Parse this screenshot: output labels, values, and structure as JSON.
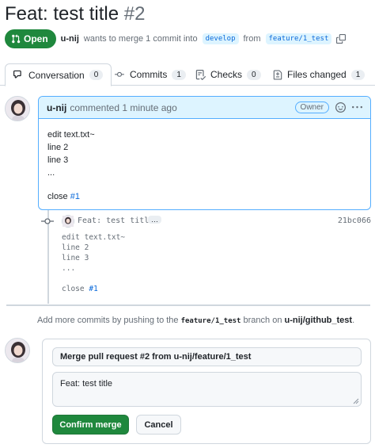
{
  "pr": {
    "title": "Feat: test title",
    "number": "#2",
    "state": "Open",
    "author": "u-nij",
    "merge_text": "wants to merge 1 commit into",
    "base_branch": "develop",
    "from_text": "from",
    "head_branch": "feature/1_test"
  },
  "tabs": [
    {
      "label": "Conversation",
      "count": "0"
    },
    {
      "label": "Commits",
      "count": "1"
    },
    {
      "label": "Checks",
      "count": "0"
    },
    {
      "label": "Files changed",
      "count": "1"
    }
  ],
  "comment": {
    "author": "u-nij",
    "meta": "commented 1 minute ago",
    "role": "Owner",
    "lines": [
      "edit text.txt~",
      "line 2",
      "line 3",
      "..."
    ],
    "close_text": "close",
    "close_ref": "#1"
  },
  "commit": {
    "title": "Feat: test title",
    "ellipsis": "…",
    "sha": "21bc066",
    "lines": [
      "edit text.txt~",
      "line 2",
      "line 3",
      "..."
    ],
    "close_text": "close",
    "close_ref": "#1"
  },
  "push_note": {
    "before": "Add more commits by pushing to the",
    "branch": "feature/1_test",
    "middle": "branch on",
    "repo": "u-nij/github_test",
    "after": "."
  },
  "merge": {
    "title_value": "Merge pull request #2 from u-nij/feature/1_test",
    "description_value": "Feat: test title",
    "confirm_label": "Confirm merge",
    "cancel_label": "Cancel"
  },
  "colors": {
    "open_green": "#1f883d",
    "link_blue": "#0969da",
    "header_blue": "#ddf4ff"
  }
}
